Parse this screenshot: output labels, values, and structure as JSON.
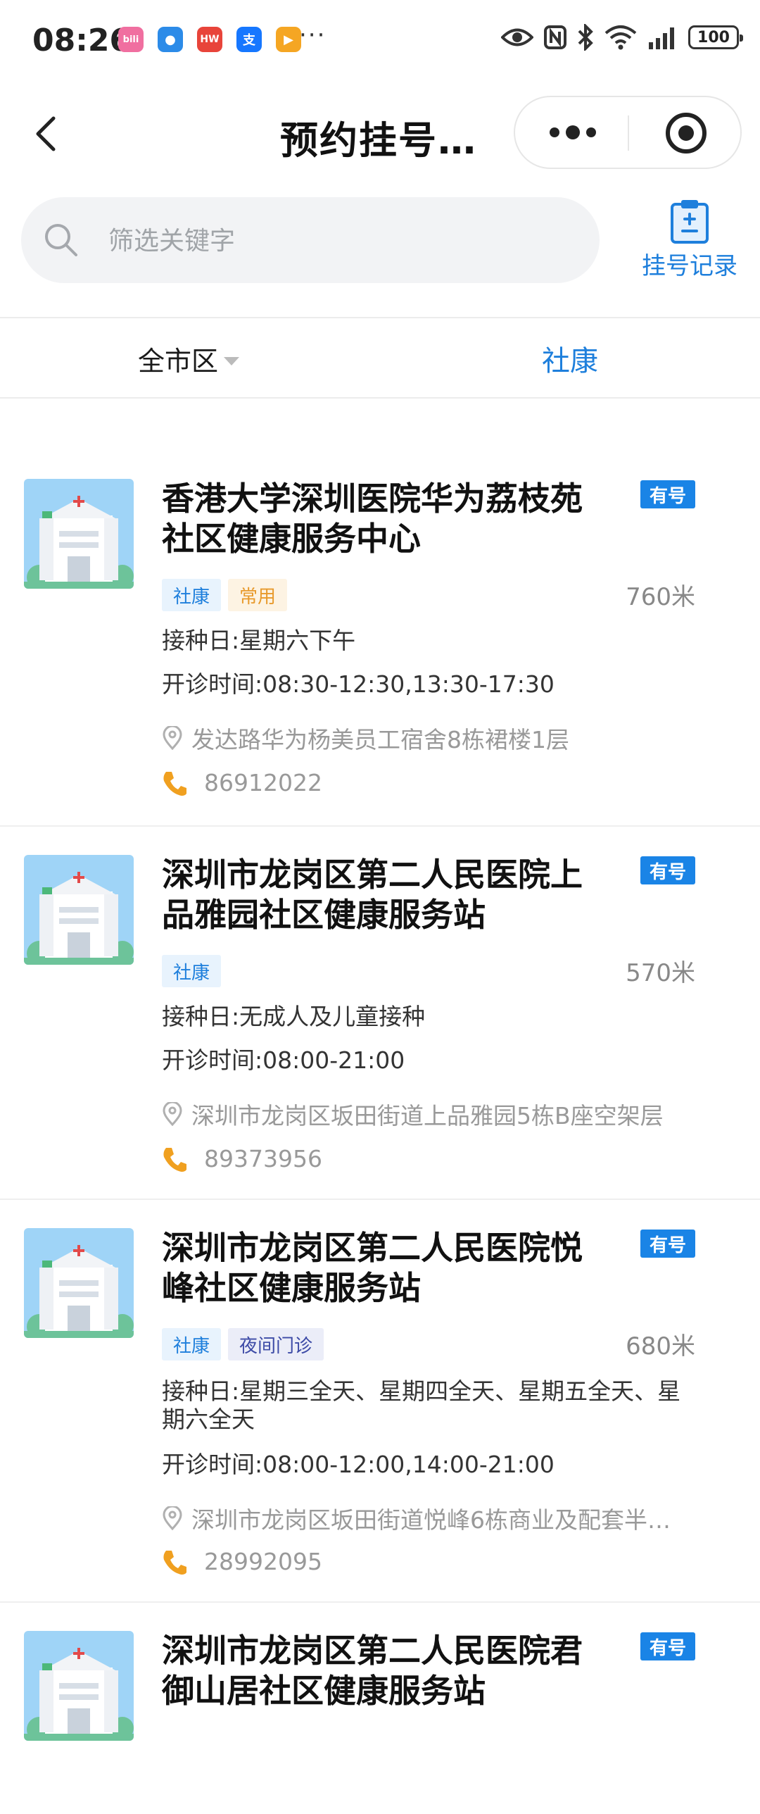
{
  "status_bar": {
    "time": "08:26",
    "apps": [
      {
        "name": "bilibili-icon",
        "glyph": "bili",
        "color": "#f06fa0"
      },
      {
        "name": "browser-icon",
        "glyph": "●",
        "color": "#2c8be8"
      },
      {
        "name": "huawei-store-icon",
        "glyph": "HW",
        "color": "#e8443a"
      },
      {
        "name": "alipay-icon",
        "glyph": "支",
        "color": "#1677ff"
      },
      {
        "name": "video-app-icon",
        "glyph": "▶",
        "color": "#f5a623"
      }
    ],
    "more": "···",
    "battery": "100"
  },
  "nav": {
    "title": "预约挂号…"
  },
  "search": {
    "placeholder": "筛选关键字"
  },
  "register_record": {
    "label": "挂号记录"
  },
  "filters": {
    "district": "全市区",
    "type": "社康"
  },
  "colors": {
    "accent": "#1e7fdc",
    "badge": "#1a84e6",
    "phone": "#f0a020"
  },
  "hospitals": [
    {
      "name": "香港大学深圳医院华为荔枝苑社区健康服务中心",
      "badge": "有号",
      "tags": [
        {
          "label": "社康",
          "style": "blue"
        },
        {
          "label": "常用",
          "style": "orange"
        }
      ],
      "distance": "760米",
      "vaccination": "接种日:星期六下午",
      "hours": "开诊时间:08:30-12:30,13:30-17:30",
      "address": "发达路华为杨美员工宿舍8栋裙楼1层",
      "phone": "86912022"
    },
    {
      "name": "深圳市龙岗区第二人民医院上品雅园社区健康服务站",
      "badge": "有号",
      "tags": [
        {
          "label": "社康",
          "style": "blue"
        }
      ],
      "distance": "570米",
      "vaccination": "接种日:无成人及儿童接种",
      "hours": "开诊时间:08:00-21:00",
      "address": "深圳市龙岗区坂田街道上品雅园5栋B座空架层",
      "phone": "89373956"
    },
    {
      "name": "深圳市龙岗区第二人民医院悦峰社区健康服务站",
      "badge": "有号",
      "tags": [
        {
          "label": "社康",
          "style": "blue"
        },
        {
          "label": "夜间门诊",
          "style": "purple"
        }
      ],
      "distance": "680米",
      "vaccination": "接种日:星期三全天、星期四全天、星期五全天、星期六全天",
      "hours": "开诊时间:08:00-12:00,14:00-21:00",
      "address": "深圳市龙岗区坂田街道悦峰6栋商业及配套半…",
      "phone": "28992095"
    },
    {
      "name": "深圳市龙岗区第二人民医院君御山居社区健康服务站",
      "badge": "有号"
    }
  ]
}
